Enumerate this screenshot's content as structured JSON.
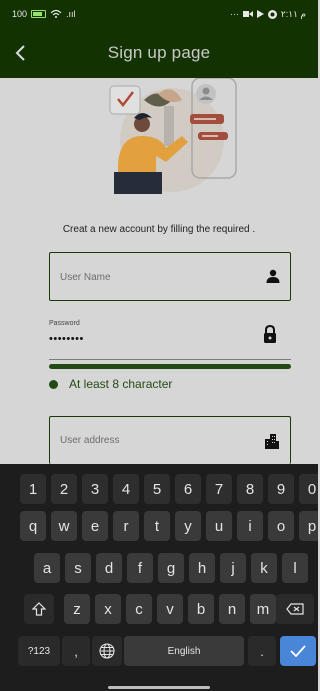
{
  "status_bar": {
    "left_text": "100",
    "signal_text": ".ııl",
    "right_dots": "···",
    "right_text": "م ٢:١١"
  },
  "app_bar": {
    "back_icon": "‹",
    "title": "Sign up page"
  },
  "form": {
    "subtitle": "Creat a new account by filling the required .",
    "username": {
      "placeholder": "User Name",
      "icon": "person-icon"
    },
    "password": {
      "label": "Password",
      "value": "••••••••",
      "icon": "lock-icon",
      "strength": 1.0
    },
    "password_hint": "At least 8 character",
    "address": {
      "placeholder": "User address",
      "icon": "city-icon"
    }
  },
  "keyboard": {
    "row_numbers": [
      "1",
      "2",
      "3",
      "4",
      "5",
      "6",
      "7",
      "8",
      "9",
      "0"
    ],
    "row_1": [
      "q",
      "w",
      "e",
      "r",
      "t",
      "y",
      "u",
      "i",
      "o",
      "p"
    ],
    "row_2": [
      "a",
      "s",
      "d",
      "f",
      "g",
      "h",
      "j",
      "k",
      "l"
    ],
    "row_3": [
      "z",
      "x",
      "c",
      "v",
      "b",
      "n",
      "m"
    ],
    "symbols_key": "?123",
    "comma_key": ",",
    "space_key": "English",
    "period_key": ".",
    "shift_icon": "shift-icon",
    "backspace_icon": "backspace-icon",
    "globe_icon": "globe-icon",
    "enter_icon": "check-icon",
    "colors": {
      "background": "#1d1d1d",
      "key": "#3a3a3a",
      "enter": "#4a86d8"
    }
  },
  "colors": {
    "primary": "#123202",
    "accent": "#234a14"
  }
}
